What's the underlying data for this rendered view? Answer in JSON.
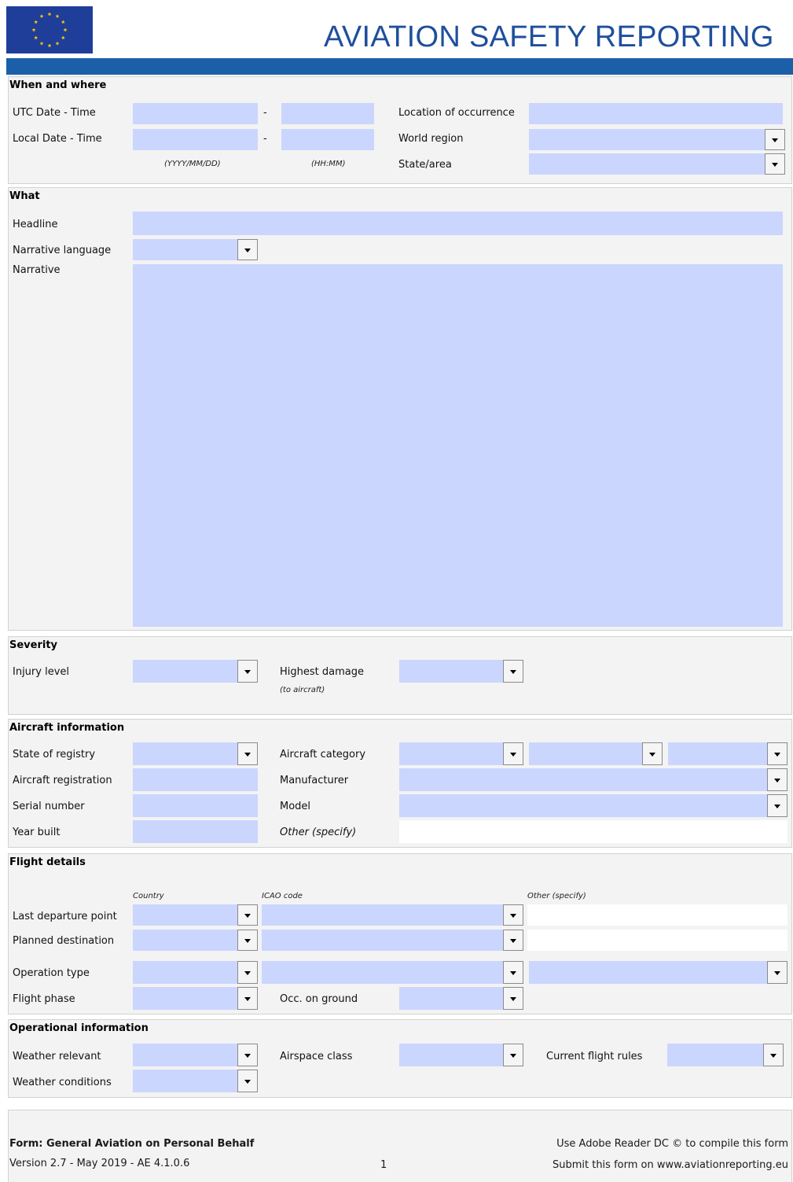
{
  "header": {
    "title": "AVIATION SAFETY REPORTING",
    "flag_color": "#1f3e9a",
    "star_color": "#ffcc00",
    "band_color": "#1b5fa8"
  },
  "when_where": {
    "title": "When and where",
    "utc_label": "UTC Date - Time",
    "local_label": "Local Date - Time",
    "dash": "-",
    "date_hint": "(YYYY/MM/DD)",
    "time_hint": "(HH:MM)",
    "location_label": "Location of occurrence",
    "region_label": "World region",
    "state_label": "State/area"
  },
  "what": {
    "title": "What",
    "headline_label": "Headline",
    "language_label": "Narrative language",
    "narrative_label": "Narrative"
  },
  "severity": {
    "title": "Severity",
    "injury_label": "Injury level",
    "damage_label": "Highest damage",
    "damage_hint": "(to aircraft)"
  },
  "aircraft": {
    "title": "Aircraft information",
    "registry_label": "State of registry",
    "registration_label": "Aircraft registration",
    "serial_label": "Serial number",
    "year_label": "Year built",
    "category_label": "Aircraft category",
    "manufacturer_label": "Manufacturer",
    "model_label": "Model",
    "other_label": "Other (specify)"
  },
  "flight": {
    "title": "Flight details",
    "country_hint": "Country",
    "icao_hint": "ICAO code",
    "other_hint": "Other (specify)",
    "departure_label": "Last departure point",
    "destination_label": "Planned destination",
    "operation_label": "Operation type",
    "phase_label": "Flight phase",
    "ground_label": "Occ. on ground"
  },
  "operational": {
    "title": "Operational information",
    "weather_relevant_label": "Weather relevant",
    "weather_conditions_label": "Weather conditions",
    "airspace_label": "Airspace class",
    "flight_rules_label": "Current flight rules"
  },
  "footer": {
    "form_name": "Form: General Aviation on Personal Behalf",
    "version": "Version 2.7 - May 2019 - AE 4.1.0.6",
    "page": "1",
    "reader_note": "Use Adobe Reader DC © to compile this form",
    "submit_note": "Submit this form on www.aviationreporting.eu"
  },
  "colors": {
    "field_fill": "#cbd6ff",
    "section_bg": "#f3f3f3"
  }
}
